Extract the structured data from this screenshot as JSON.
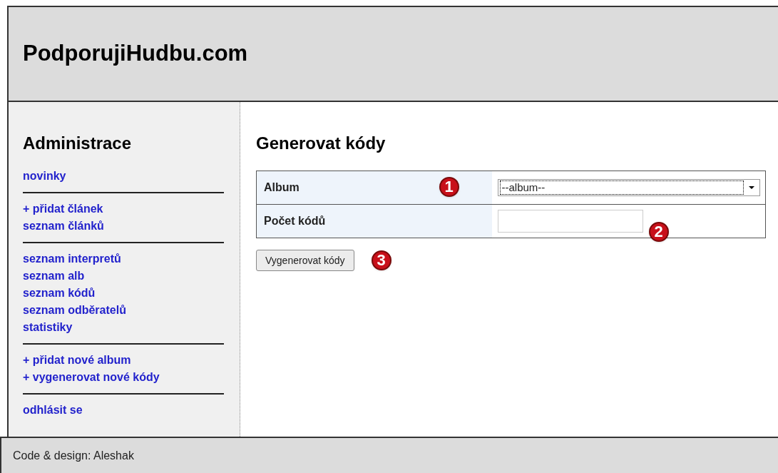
{
  "header": {
    "title": "PodporujiHudbu.com"
  },
  "sidebar": {
    "title": "Administrace",
    "groups": [
      [
        "novinky"
      ],
      [
        "+ přidat článek",
        "seznam článků"
      ],
      [
        "seznam interpretů",
        "seznam alb",
        "seznam kódů",
        "seznam odběratelů",
        "statistiky"
      ],
      [
        "+ přidat nové album",
        "+ vygenerovat nové kódy"
      ],
      [
        "odhlásit se"
      ]
    ]
  },
  "main": {
    "title": "Generovat kódy",
    "form": [
      {
        "label": "Album",
        "kind": "select",
        "value": "--album--",
        "callout": "1"
      },
      {
        "label": "Počet kódů",
        "kind": "input",
        "callout": "2"
      }
    ],
    "button": "Vygenerovat kódy",
    "button_callout": "3"
  },
  "footer": "Code & design: Aleshak"
}
